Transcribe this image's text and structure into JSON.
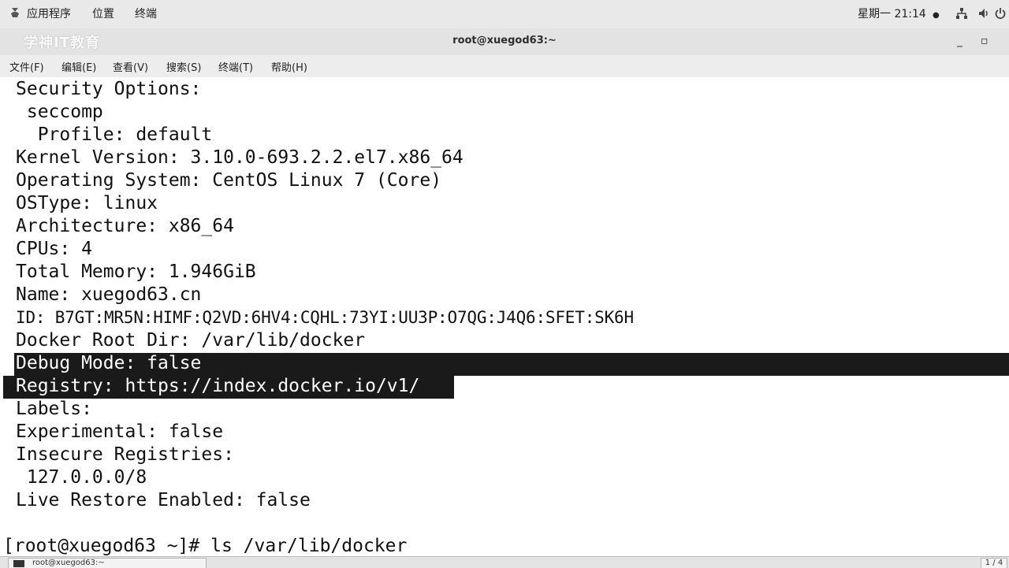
{
  "top_panel": {
    "applications": "应用程序",
    "places": "位置",
    "terminal": "终端",
    "clock": "星期一 21:14",
    "icons": [
      "applications-icon",
      "network-icon",
      "volume-icon",
      "power-icon"
    ]
  },
  "window": {
    "title": "root@xuegod63:~",
    "watermark": "学神IT教育",
    "minimize": "_",
    "maximize": "▫"
  },
  "menubar": {
    "items": [
      "文件(F)",
      "编辑(E)",
      "查看(V)",
      "搜索(S)",
      "终端(T)",
      "帮助(H)"
    ]
  },
  "terminal": {
    "lines": [
      "Security Options:",
      " seccomp",
      "  Profile: default",
      "Kernel Version: 3.10.0-693.2.2.el7.x86_64",
      "Operating System: CentOS Linux 7 (Core)",
      "OSType: linux",
      "Architecture: x86_64",
      "CPUs: 4",
      "Total Memory: 1.946GiB",
      "Name: xuegod63.cn",
      "ID: B7GT:MR5N:HIMF:Q2VD:6HV4:CQHL:73YI:UU3P:O7QG:J4Q6:SFET:SK6H",
      "Docker Root Dir: /var/lib/docker",
      "Debug Mode: false",
      "Registry: https://index.docker.io/v1/",
      "Labels:",
      "Experimental: false",
      "Insecure Registries:",
      " 127.0.0.0/8",
      "Live Restore Enabled: false",
      "",
      "[root@xuegod63 ~]# ls /var/lib/docker"
    ],
    "selected_lines": [
      "Debug Mode: false",
      "Registry: https://index.docker.io/v1/"
    ]
  },
  "taskbar": {
    "item": "root@xuegod63:~",
    "workspace": "1 / 4"
  }
}
